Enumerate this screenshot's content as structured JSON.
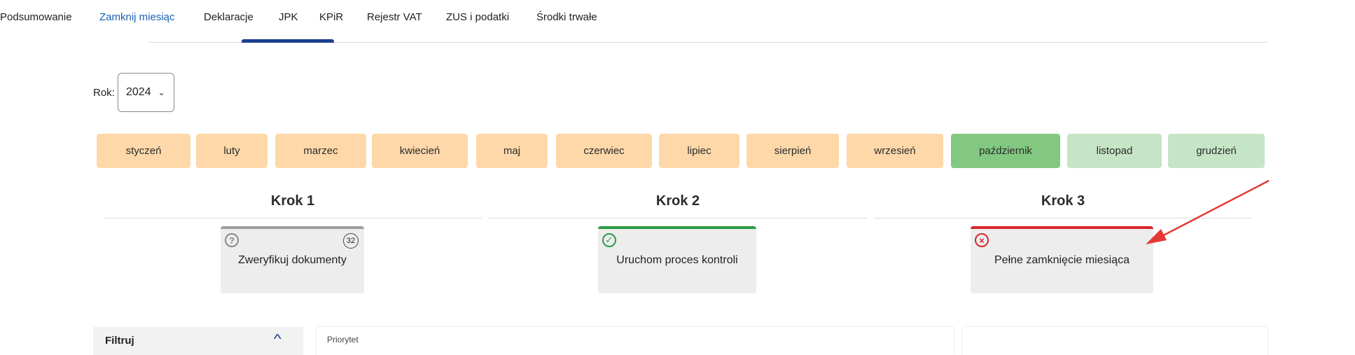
{
  "tabs": [
    {
      "label": "Podsumowanie",
      "active": false
    },
    {
      "label": "Zamknij miesiąc",
      "active": true
    },
    {
      "label": "Deklaracje",
      "active": false
    },
    {
      "label": "JPK",
      "active": false
    },
    {
      "label": "KPiR",
      "active": false
    },
    {
      "label": "Rejestr VAT",
      "active": false
    },
    {
      "label": "ZUS i podatki",
      "active": false
    },
    {
      "label": "Środki trwałe",
      "active": false
    }
  ],
  "year": {
    "label": "Rok:",
    "value": "2024"
  },
  "months": [
    {
      "label": "styczeń",
      "state": "closed"
    },
    {
      "label": "luty",
      "state": "closed"
    },
    {
      "label": "marzec",
      "state": "closed"
    },
    {
      "label": "kwiecień",
      "state": "closed"
    },
    {
      "label": "maj",
      "state": "closed"
    },
    {
      "label": "czerwiec",
      "state": "closed"
    },
    {
      "label": "lipiec",
      "state": "closed"
    },
    {
      "label": "sierpień",
      "state": "closed"
    },
    {
      "label": "wrzesień",
      "state": "closed"
    },
    {
      "label": "październik",
      "state": "selected"
    },
    {
      "label": "listopad",
      "state": "open"
    },
    {
      "label": "grudzień",
      "state": "open"
    }
  ],
  "steps": [
    {
      "title": "Krok 1",
      "card": "Zweryfikuj dokumenty",
      "status": "question",
      "count": "32",
      "bar_color": "#9e9e9e"
    },
    {
      "title": "Krok 2",
      "card": "Uruchom proces kontroli",
      "status": "ok",
      "bar_color": "#2e9b45"
    },
    {
      "title": "Krok 3",
      "card": "Pełne zamknięcie miesiąca",
      "status": "error",
      "bar_color": "#d8262b"
    }
  ],
  "filter": {
    "label": "Filtruj"
  },
  "list": {
    "priority_label": "Priorytet"
  },
  "colors": {
    "accent": "#1a3f8f",
    "month_closed": "#fed8a9",
    "month_selected": "#82c881",
    "month_open": "#c6e5c6",
    "annotation_arrow": "#e53935"
  }
}
